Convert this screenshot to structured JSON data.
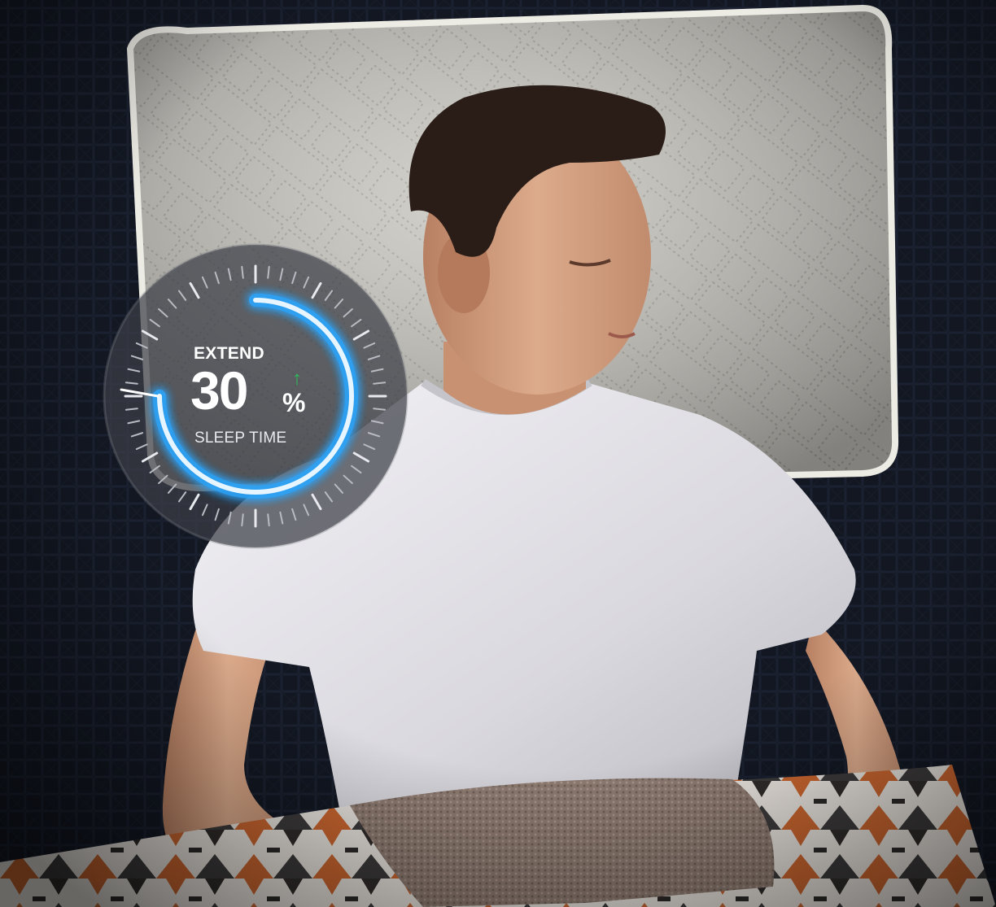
{
  "badge": {
    "top_label": "EXTEND",
    "value": "30",
    "unit": "%",
    "arrow": "↑",
    "bottom_label": "SLEEP TIME",
    "ring_fraction": 0.75,
    "ring_color": "#2aa6ff",
    "arrow_color": "#2ebd59"
  },
  "scene_icons": [
    "man-sleeping-illustration",
    "pillow-illustration",
    "blanket-illustration"
  ]
}
